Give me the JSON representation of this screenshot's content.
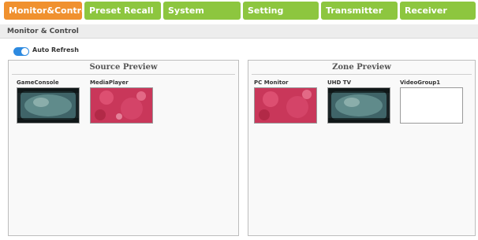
{
  "tabs": [
    {
      "label": "Monitor&Control",
      "active": true
    },
    {
      "label": "Preset Recall",
      "active": false
    },
    {
      "label": "System",
      "active": false
    },
    {
      "label": "Setting",
      "active": false
    },
    {
      "label": "Transmitter",
      "active": false
    },
    {
      "label": "Receiver",
      "active": false
    }
  ],
  "breadcrumb": "Monitor & Control",
  "auto_refresh": {
    "label": "Auto Refresh",
    "enabled": true
  },
  "source_preview": {
    "title": "Source Preview",
    "items": [
      {
        "label": "GameConsole",
        "preview": "dark-scene"
      },
      {
        "label": "MediaPlayer",
        "preview": "pink-scene"
      }
    ]
  },
  "zone_preview": {
    "title": "Zone Preview",
    "items": [
      {
        "label": "PC Monitor",
        "preview": "pink-scene"
      },
      {
        "label": "UHD TV",
        "preview": "dark-scene"
      },
      {
        "label": "VideoGroup1",
        "preview": "blank"
      }
    ]
  },
  "colors": {
    "tab_green": "#8dc63f",
    "tab_active_orange": "#f0912f",
    "toggle_blue": "#2d8ae0"
  }
}
